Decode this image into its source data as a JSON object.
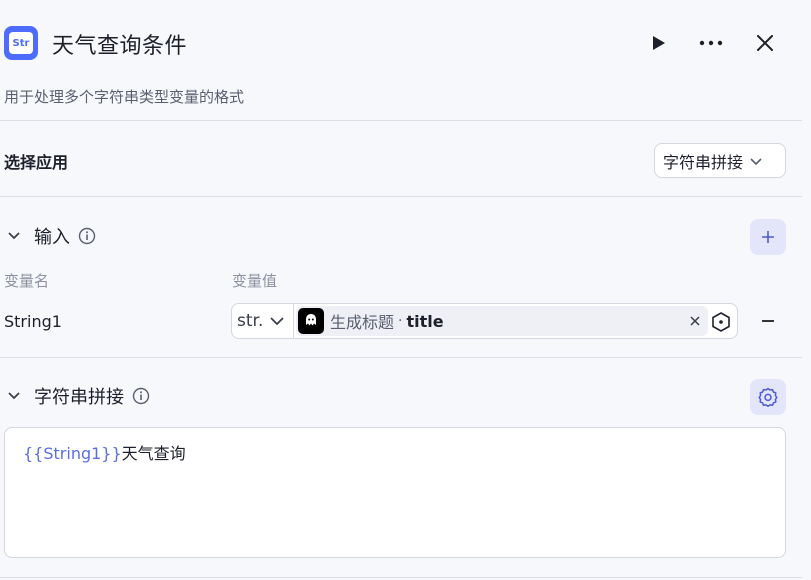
{
  "header": {
    "icon_text": "Str",
    "title": "天气查询条件",
    "subtitle": "用于处理多个字符串类型变量的格式"
  },
  "select_app": {
    "label": "选择应用",
    "value": "字符串拼接"
  },
  "input_section": {
    "title": "输入",
    "columns": {
      "name": "变量名",
      "value": "变量值"
    },
    "rows": [
      {
        "name": "String1",
        "type": "str.",
        "ref_node": "生成标题",
        "ref_separator": "·",
        "ref_field": "title"
      }
    ]
  },
  "concat_section": {
    "title": "字符串拼接",
    "template_var": "{{String1}}",
    "template_text": "天气查询"
  },
  "colors": {
    "accent": "#4d6bfe",
    "button_bg": "#e3e5fb",
    "template_var": "#5b6ee1"
  }
}
